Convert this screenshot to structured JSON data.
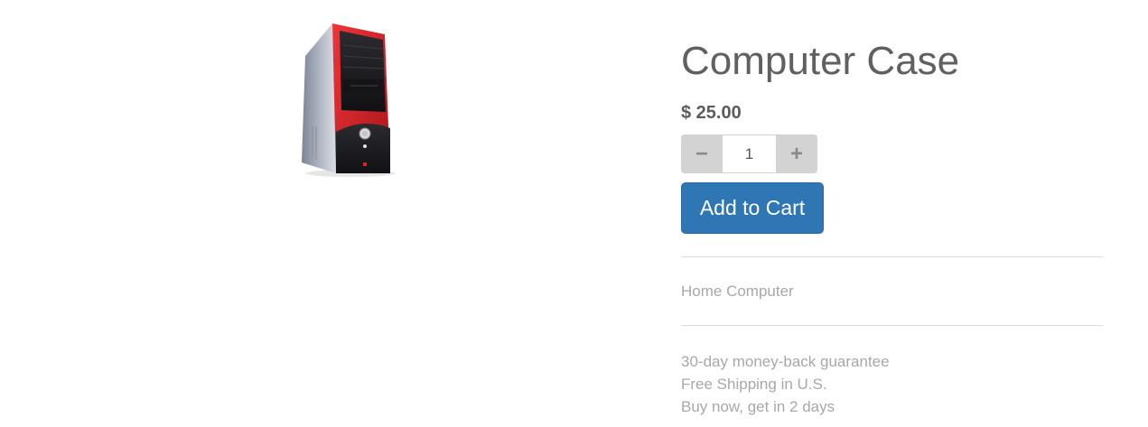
{
  "product": {
    "image_alt": "computer-case-image",
    "title": "Computer Case",
    "price": "$ 25.00",
    "quantity": {
      "decrement_label": "−",
      "value": "1",
      "increment_label": "+"
    },
    "add_to_cart_label": "Add to Cart",
    "category": "Home Computer",
    "features": [
      "30-day money-back guarantee",
      "Free Shipping in U.S.",
      "Buy now, get in 2 days"
    ]
  },
  "colors": {
    "accent": "#2e77b4",
    "case_red": "#d8242a",
    "case_black": "#1c1c1e",
    "text_muted": "#a8a8a8",
    "text_dark": "#606060"
  }
}
